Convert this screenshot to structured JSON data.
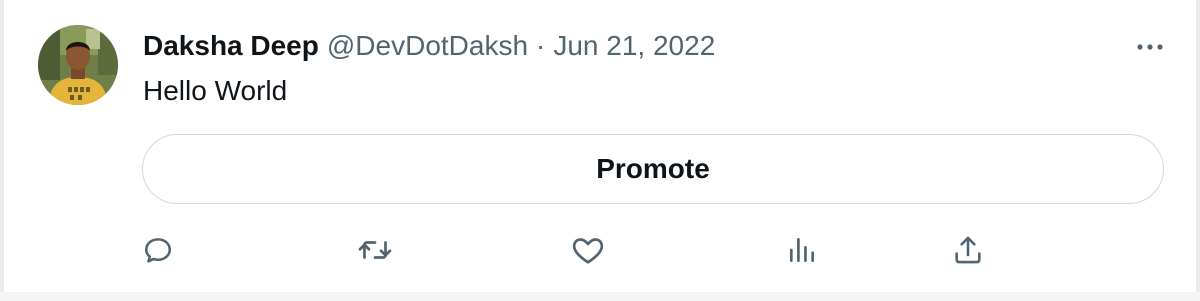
{
  "tweet": {
    "author_name": "Daksha Deep",
    "handle": "@DevDotDaksh",
    "separator": "·",
    "date": "Jun 21, 2022",
    "text": "Hello World",
    "promote_label": "Promote"
  },
  "icons": {
    "more": "more-horizontal-icon",
    "reply": "reply-icon",
    "retweet": "retweet-icon",
    "like": "heart-icon",
    "views": "analytics-icon",
    "share": "share-icon"
  },
  "colors": {
    "text_primary": "#0f1419",
    "text_secondary": "#536471",
    "border": "#cfd9de",
    "background": "#ffffff"
  }
}
